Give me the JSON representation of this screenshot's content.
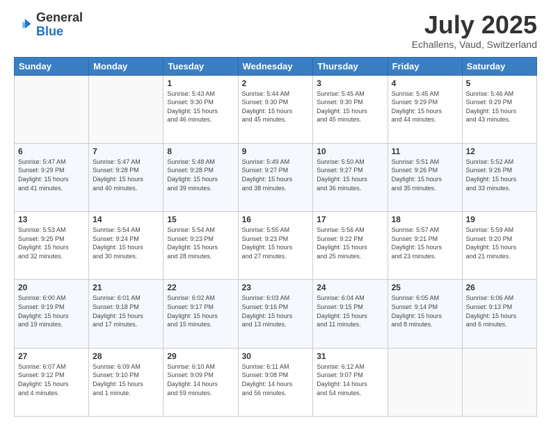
{
  "logo": {
    "general": "General",
    "blue": "Blue"
  },
  "header": {
    "month": "July 2025",
    "location": "Echallens, Vaud, Switzerland"
  },
  "days_of_week": [
    "Sunday",
    "Monday",
    "Tuesday",
    "Wednesday",
    "Thursday",
    "Friday",
    "Saturday"
  ],
  "weeks": [
    [
      {
        "day": "",
        "info": ""
      },
      {
        "day": "",
        "info": ""
      },
      {
        "day": "1",
        "info": "Sunrise: 5:43 AM\nSunset: 9:30 PM\nDaylight: 15 hours\nand 46 minutes."
      },
      {
        "day": "2",
        "info": "Sunrise: 5:44 AM\nSunset: 9:30 PM\nDaylight: 15 hours\nand 45 minutes."
      },
      {
        "day": "3",
        "info": "Sunrise: 5:45 AM\nSunset: 9:30 PM\nDaylight: 15 hours\nand 45 minutes."
      },
      {
        "day": "4",
        "info": "Sunrise: 5:45 AM\nSunset: 9:29 PM\nDaylight: 15 hours\nand 44 minutes."
      },
      {
        "day": "5",
        "info": "Sunrise: 5:46 AM\nSunset: 9:29 PM\nDaylight: 15 hours\nand 43 minutes."
      }
    ],
    [
      {
        "day": "6",
        "info": "Sunrise: 5:47 AM\nSunset: 9:29 PM\nDaylight: 15 hours\nand 41 minutes."
      },
      {
        "day": "7",
        "info": "Sunrise: 5:47 AM\nSunset: 9:28 PM\nDaylight: 15 hours\nand 40 minutes."
      },
      {
        "day": "8",
        "info": "Sunrise: 5:48 AM\nSunset: 9:28 PM\nDaylight: 15 hours\nand 39 minutes."
      },
      {
        "day": "9",
        "info": "Sunrise: 5:49 AM\nSunset: 9:27 PM\nDaylight: 15 hours\nand 38 minutes."
      },
      {
        "day": "10",
        "info": "Sunrise: 5:50 AM\nSunset: 9:27 PM\nDaylight: 15 hours\nand 36 minutes."
      },
      {
        "day": "11",
        "info": "Sunrise: 5:51 AM\nSunset: 9:26 PM\nDaylight: 15 hours\nand 35 minutes."
      },
      {
        "day": "12",
        "info": "Sunrise: 5:52 AM\nSunset: 9:26 PM\nDaylight: 15 hours\nand 33 minutes."
      }
    ],
    [
      {
        "day": "13",
        "info": "Sunrise: 5:53 AM\nSunset: 9:25 PM\nDaylight: 15 hours\nand 32 minutes."
      },
      {
        "day": "14",
        "info": "Sunrise: 5:54 AM\nSunset: 9:24 PM\nDaylight: 15 hours\nand 30 minutes."
      },
      {
        "day": "15",
        "info": "Sunrise: 5:54 AM\nSunset: 9:23 PM\nDaylight: 15 hours\nand 28 minutes."
      },
      {
        "day": "16",
        "info": "Sunrise: 5:55 AM\nSunset: 9:23 PM\nDaylight: 15 hours\nand 27 minutes."
      },
      {
        "day": "17",
        "info": "Sunrise: 5:56 AM\nSunset: 9:22 PM\nDaylight: 15 hours\nand 25 minutes."
      },
      {
        "day": "18",
        "info": "Sunrise: 5:57 AM\nSunset: 9:21 PM\nDaylight: 15 hours\nand 23 minutes."
      },
      {
        "day": "19",
        "info": "Sunrise: 5:59 AM\nSunset: 9:20 PM\nDaylight: 15 hours\nand 21 minutes."
      }
    ],
    [
      {
        "day": "20",
        "info": "Sunrise: 6:00 AM\nSunset: 9:19 PM\nDaylight: 15 hours\nand 19 minutes."
      },
      {
        "day": "21",
        "info": "Sunrise: 6:01 AM\nSunset: 9:18 PM\nDaylight: 15 hours\nand 17 minutes."
      },
      {
        "day": "22",
        "info": "Sunrise: 6:02 AM\nSunset: 9:17 PM\nDaylight: 15 hours\nand 15 minutes."
      },
      {
        "day": "23",
        "info": "Sunrise: 6:03 AM\nSunset: 9:16 PM\nDaylight: 15 hours\nand 13 minutes."
      },
      {
        "day": "24",
        "info": "Sunrise: 6:04 AM\nSunset: 9:15 PM\nDaylight: 15 hours\nand 11 minutes."
      },
      {
        "day": "25",
        "info": "Sunrise: 6:05 AM\nSunset: 9:14 PM\nDaylight: 15 hours\nand 8 minutes."
      },
      {
        "day": "26",
        "info": "Sunrise: 6:06 AM\nSunset: 9:13 PM\nDaylight: 15 hours\nand 6 minutes."
      }
    ],
    [
      {
        "day": "27",
        "info": "Sunrise: 6:07 AM\nSunset: 9:12 PM\nDaylight: 15 hours\nand 4 minutes."
      },
      {
        "day": "28",
        "info": "Sunrise: 6:09 AM\nSunset: 9:10 PM\nDaylight: 15 hours\nand 1 minute."
      },
      {
        "day": "29",
        "info": "Sunrise: 6:10 AM\nSunset: 9:09 PM\nDaylight: 14 hours\nand 59 minutes."
      },
      {
        "day": "30",
        "info": "Sunrise: 6:11 AM\nSunset: 9:08 PM\nDaylight: 14 hours\nand 56 minutes."
      },
      {
        "day": "31",
        "info": "Sunrise: 6:12 AM\nSunset: 9:07 PM\nDaylight: 14 hours\nand 54 minutes."
      },
      {
        "day": "",
        "info": ""
      },
      {
        "day": "",
        "info": ""
      }
    ]
  ]
}
